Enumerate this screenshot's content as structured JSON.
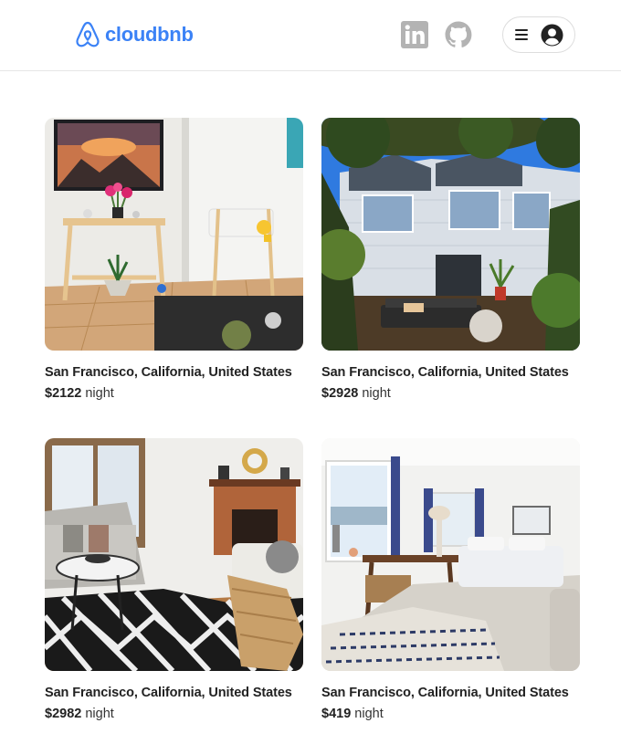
{
  "brand": {
    "name": "cloudbnb",
    "color": "#3b82f6"
  },
  "header": {
    "social": [
      {
        "icon": "linkedin-icon"
      },
      {
        "icon": "github-icon"
      }
    ],
    "user_menu": {
      "icons": [
        "menu-icon",
        "user-avatar-icon"
      ]
    }
  },
  "listings": [
    {
      "location": "San Francisco, California, United States",
      "price": "$2122",
      "unit": "night"
    },
    {
      "location": "San Francisco, California, United States",
      "price": "$2928",
      "unit": "night"
    },
    {
      "location": "San Francisco, California, United States",
      "price": "$2982",
      "unit": "night"
    },
    {
      "location": "San Francisco, California, United States",
      "price": "$419",
      "unit": "night"
    }
  ]
}
